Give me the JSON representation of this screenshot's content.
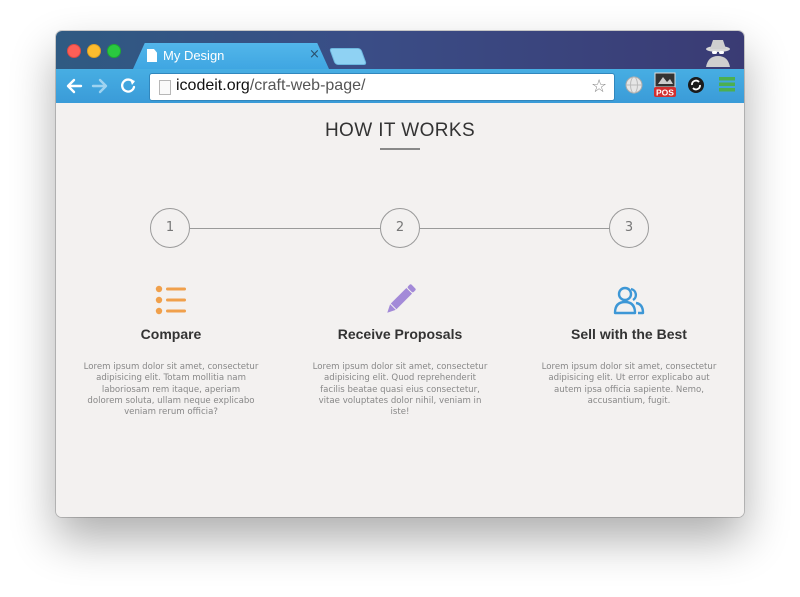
{
  "browser": {
    "tab_title": "My Design",
    "tab_close": "×",
    "url_domain": "icodeit.org",
    "url_path": "/craft-web-page/",
    "bookmark_star": "☆",
    "extensions": {
      "pos_label": "POS"
    }
  },
  "page": {
    "section_title": "HOW IT WORKS",
    "steps": [
      {
        "number": "1"
      },
      {
        "number": "2"
      },
      {
        "number": "3"
      }
    ],
    "features": [
      {
        "icon": "list-icon",
        "icon_color": "#f0a04b",
        "heading": "Compare",
        "body": "Lorem ipsum dolor sit amet, consectetur adipisicing elit. Totam mollitia nam laboriosam rem itaque, aperiam dolorem soluta, ullam neque explicabo veniam rerum officia?"
      },
      {
        "icon": "pencil-icon",
        "icon_color": "#a38ad8",
        "heading": "Receive Proposals",
        "body": "Lorem ipsum dolor sit amet, consectetur adipisicing elit. Quod reprehenderit facilis beatae quasi eius consectetur, vitae voluptates dolor nihil, veniam in iste!"
      },
      {
        "icon": "users-icon",
        "icon_color": "#3d97d6",
        "heading": "Sell with the Best",
        "body": "Lorem ipsum dolor sit amet, consectetur adipisicing elit. Ut error explicabo aut autem ipsa officia sapiente. Nemo, accusantium, fugit."
      }
    ]
  },
  "colors": {
    "tab": "#3fa6e2",
    "toolbar": "#47aee3",
    "page_background": "#f3f1f0",
    "text_dark": "#333333",
    "text_muted": "#888888"
  }
}
